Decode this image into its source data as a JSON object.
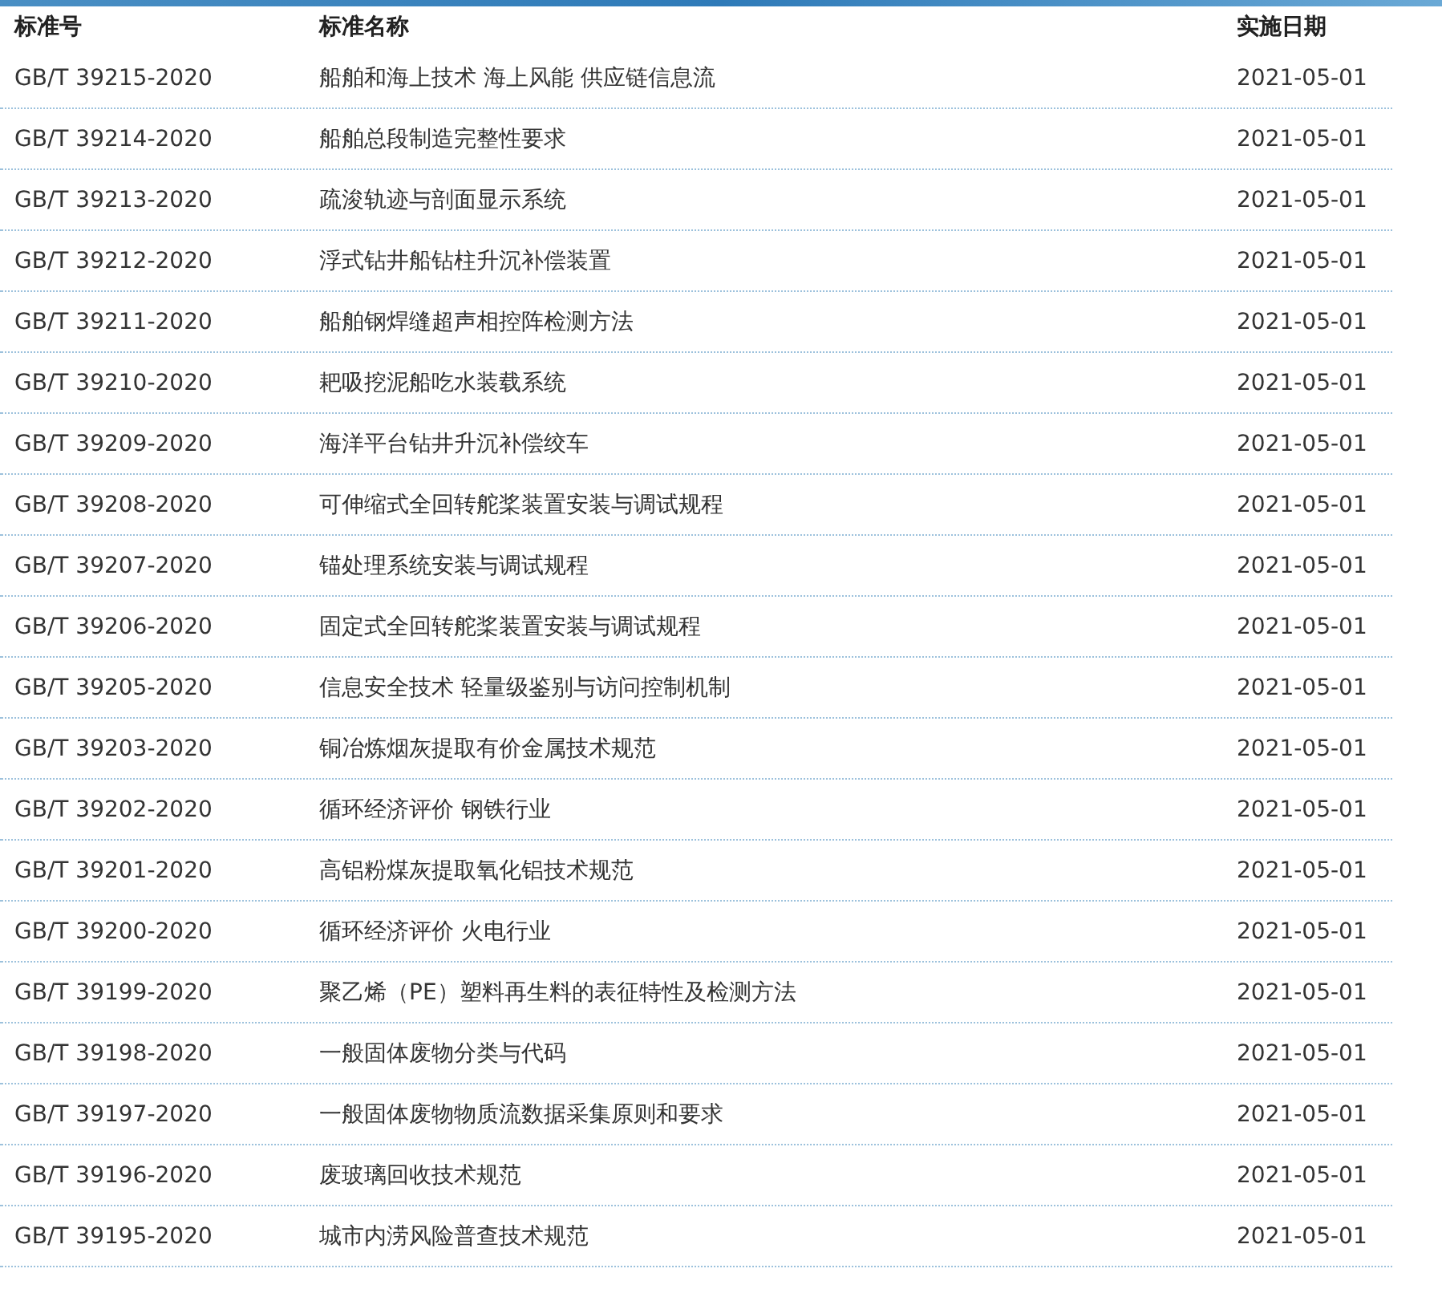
{
  "table": {
    "columns": [
      "标准号",
      "标准名称",
      "实施日期"
    ],
    "rows": [
      [
        "GB/T 39215-2020",
        "船舶和海上技术 海上风能 供应链信息流",
        "2021-05-01"
      ],
      [
        "GB/T 39214-2020",
        "船舶总段制造完整性要求",
        "2021-05-01"
      ],
      [
        "GB/T 39213-2020",
        "疏浚轨迹与剖面显示系统",
        "2021-05-01"
      ],
      [
        "GB/T 39212-2020",
        "浮式钻井船钻柱升沉补偿装置",
        "2021-05-01"
      ],
      [
        "GB/T 39211-2020",
        "船舶钢焊缝超声相控阵检测方法",
        "2021-05-01"
      ],
      [
        "GB/T 39210-2020",
        "耙吸挖泥船吃水装载系统",
        "2021-05-01"
      ],
      [
        "GB/T 39209-2020",
        "海洋平台钻井升沉补偿绞车",
        "2021-05-01"
      ],
      [
        "GB/T 39208-2020",
        "可伸缩式全回转舵桨装置安装与调试规程",
        "2021-05-01"
      ],
      [
        "GB/T 39207-2020",
        "锚处理系统安装与调试规程",
        "2021-05-01"
      ],
      [
        "GB/T 39206-2020",
        "固定式全回转舵桨装置安装与调试规程",
        "2021-05-01"
      ],
      [
        "GB/T 39205-2020",
        "信息安全技术 轻量级鉴别与访问控制机制",
        "2021-05-01"
      ],
      [
        "GB/T 39203-2020",
        "铜冶炼烟灰提取有价金属技术规范",
        "2021-05-01"
      ],
      [
        "GB/T 39202-2020",
        "循环经济评价 钢铁行业",
        "2021-05-01"
      ],
      [
        "GB/T 39201-2020",
        "高铝粉煤灰提取氧化铝技术规范",
        "2021-05-01"
      ],
      [
        "GB/T 39200-2020",
        "循环经济评价 火电行业",
        "2021-05-01"
      ],
      [
        "GB/T 39199-2020",
        "聚乙烯（PE）塑料再生料的表征特性及检测方法",
        "2021-05-01"
      ],
      [
        "GB/T 39198-2020",
        "一般固体废物分类与代码",
        "2021-05-01"
      ],
      [
        "GB/T 39197-2020",
        "一般固体废物物质流数据采集原则和要求",
        "2021-05-01"
      ],
      [
        "GB/T 39196-2020",
        "废玻璃回收技术规范",
        "2021-05-01"
      ],
      [
        "GB/T 39195-2020",
        "城市内涝风险普查技术规范",
        "2021-05-01"
      ]
    ]
  }
}
